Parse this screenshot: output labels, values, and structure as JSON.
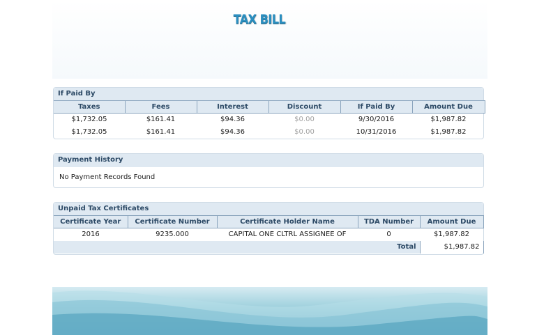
{
  "title": "TAX BILL",
  "paid_by": {
    "heading": "If Paid By",
    "columns": [
      "Taxes",
      "Fees",
      "Interest",
      "Discount",
      "If Paid By",
      "Amount Due"
    ],
    "rows": [
      [
        "$1,732.05",
        "$161.41",
        "$94.36",
        "$0.00",
        "9/30/2016",
        "$1,987.82"
      ],
      [
        "$1,732.05",
        "$161.41",
        "$94.36",
        "$0.00",
        "10/31/2016",
        "$1,987.82"
      ]
    ]
  },
  "payment_history": {
    "heading": "Payment History",
    "message": "No Payment Records Found"
  },
  "certificates": {
    "heading": "Unpaid Tax Certificates",
    "columns": [
      "Certificate Year",
      "Certificate Number",
      "Certificate Holder Name",
      "TDA Number",
      "Amount Due"
    ],
    "rows": [
      [
        "2016",
        "9235.000",
        "CAPITAL ONE CLTRL ASSIGNEE OF",
        "0",
        "$1,987.82"
      ]
    ],
    "total_label": "Total",
    "total_value": "$1,987.82"
  },
  "colors": {
    "accent": "#2b8fc0",
    "panel_header": "#dfe9f2",
    "header_text": "#2d4a66",
    "muted_text": "#a0a0a0"
  }
}
